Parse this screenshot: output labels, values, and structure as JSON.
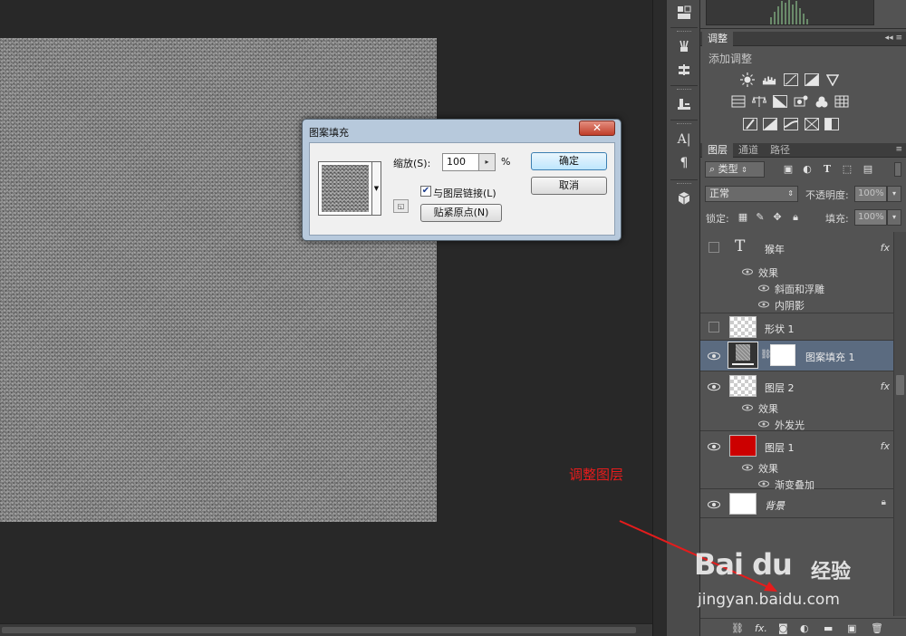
{
  "dialog": {
    "title": "图案填充",
    "close_glyph": "✕",
    "scale_label": "缩放(S):",
    "scale_value": "100",
    "scale_unit": "%",
    "link_checked": true,
    "link_label": "与图层链接(L)",
    "snap_button": "贴紧原点(N)",
    "ok_button": "确定",
    "cancel_button": "取消"
  },
  "panels": {
    "adjust_tab": "调整",
    "adjust_subtitle": "添加调整",
    "layers_tabs": [
      "图层",
      "通道",
      "路径"
    ],
    "filter_kind": "类型",
    "blend_mode": "正常",
    "opacity_label": "不透明度:",
    "opacity_value": "100%",
    "lock_label": "锁定:",
    "fill_label": "填充:",
    "fill_value": "100%"
  },
  "layers": [
    {
      "name": "猴年",
      "type": "text",
      "visible": false,
      "fx": "fx",
      "effects_label": "效果",
      "effects": [
        "斜面和浮雕",
        "内阴影"
      ]
    },
    {
      "name": "形状 1",
      "type": "shape",
      "visible": false
    },
    {
      "name": "图案填充 1",
      "type": "pattern-fill",
      "visible": true,
      "selected": true
    },
    {
      "name": "图层 2",
      "type": "pixel",
      "visible": true,
      "fx": "fx",
      "effects_label": "效果",
      "effects": [
        "外发光"
      ]
    },
    {
      "name": "图层 1",
      "type": "pixel-red",
      "visible": true,
      "fx": "fx",
      "effects_label": "效果",
      "effects": [
        "渐变叠加"
      ],
      "color": "#cc0000"
    },
    {
      "name": "背景",
      "type": "background",
      "visible": true,
      "locked": true
    }
  ],
  "annotation": {
    "text": "调整图层",
    "color": "#e51c1c"
  },
  "watermark": {
    "logo": "Bai du",
    "cn": "经验",
    "url": "jingyan.baidu.com"
  },
  "colors": {
    "selected_layer": "#5b6b80",
    "panel_bg": "#535353",
    "dialog_frame": "#b7c9dc"
  }
}
